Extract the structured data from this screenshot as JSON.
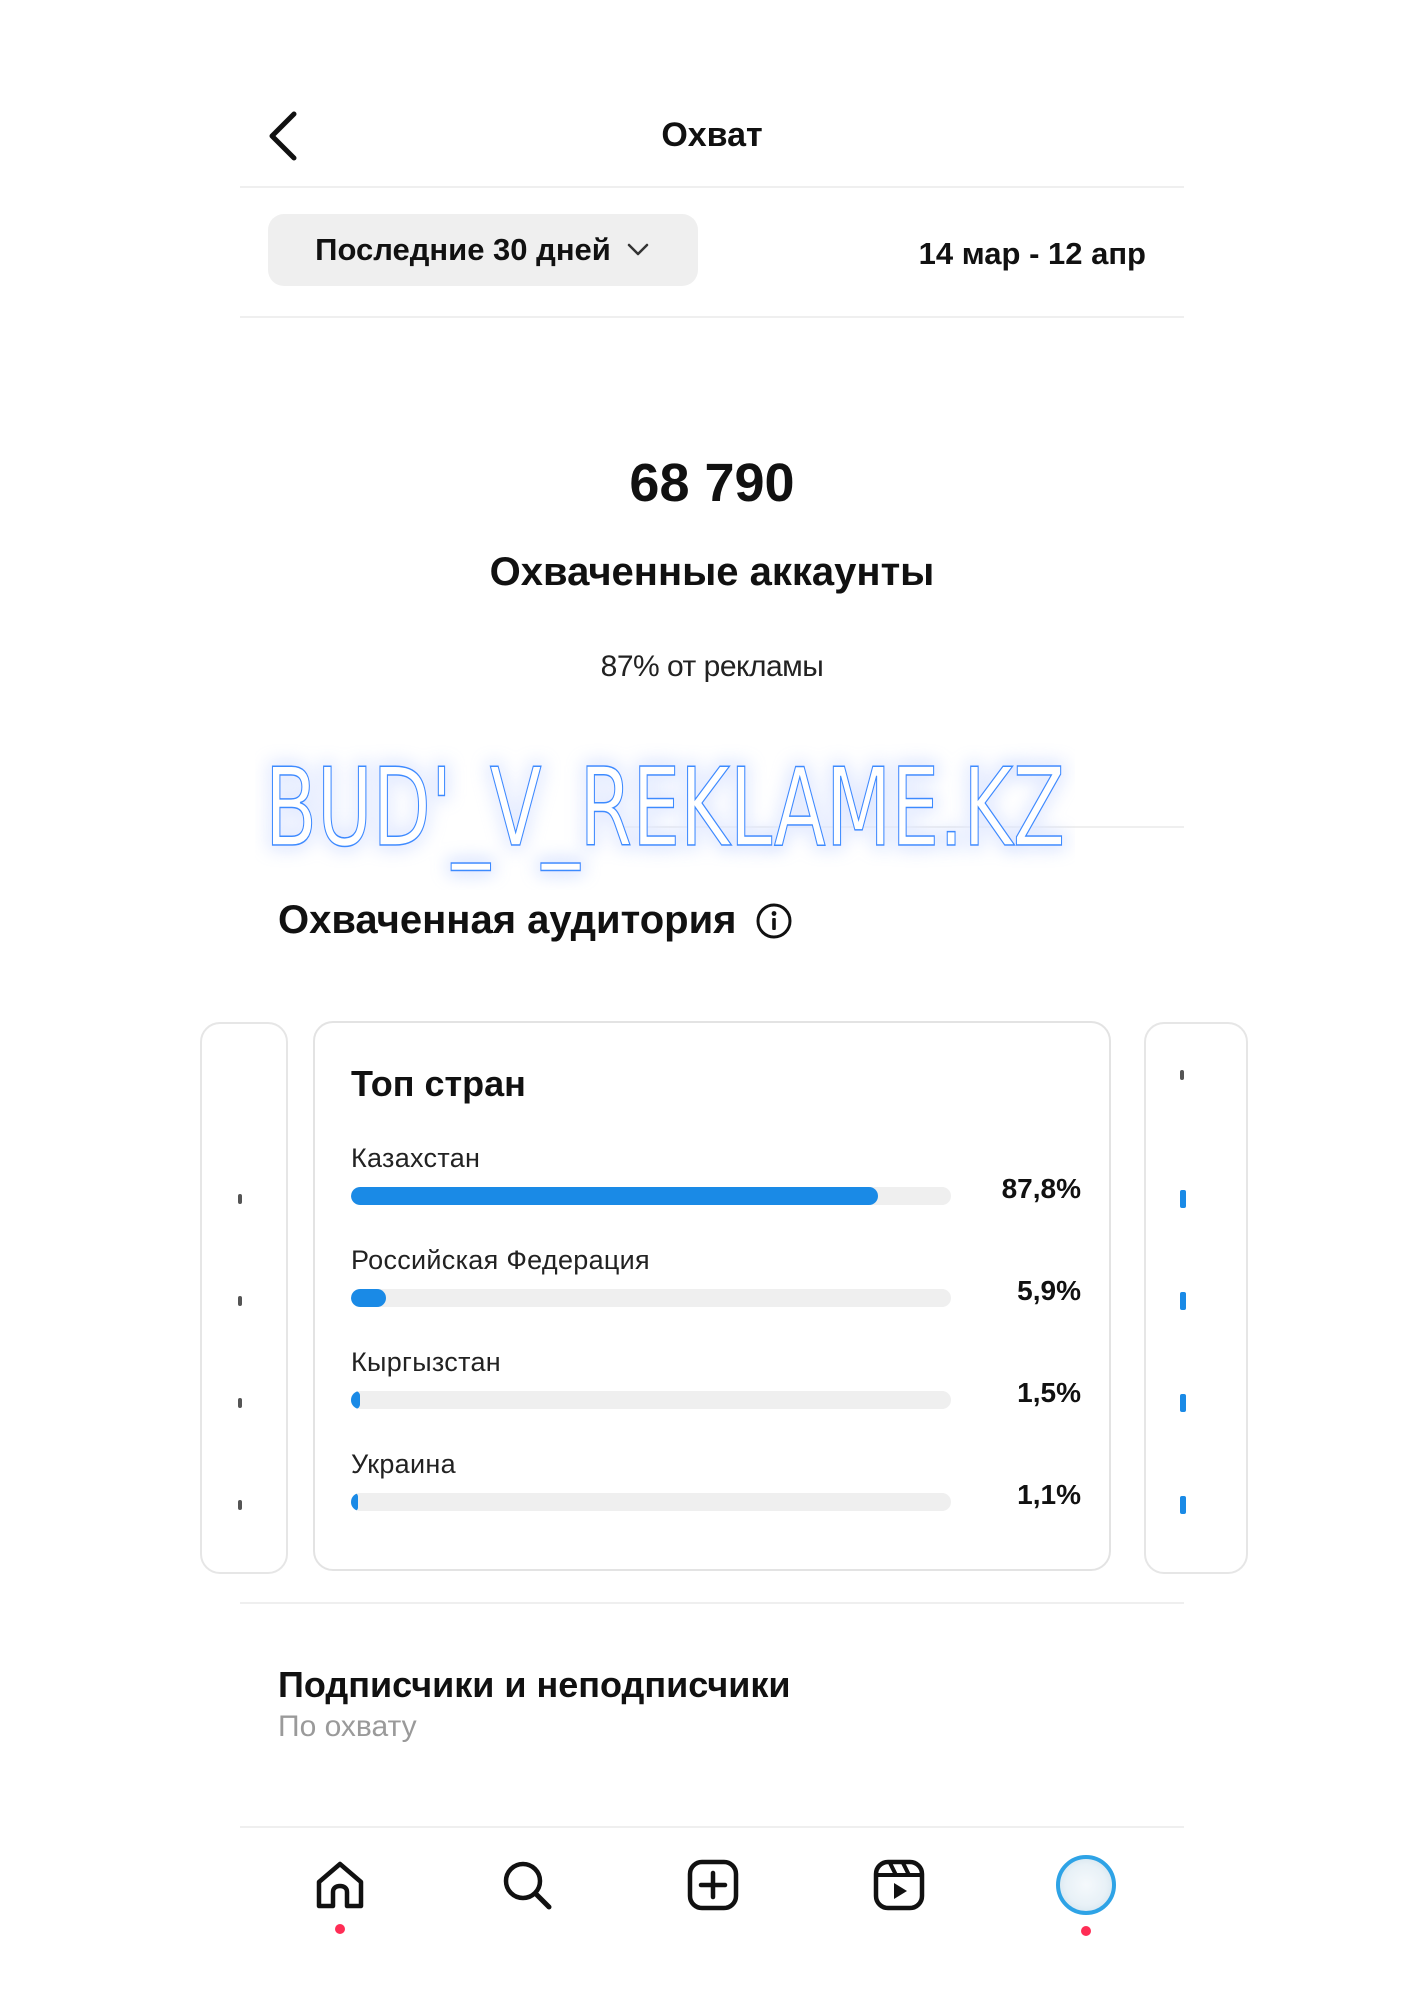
{
  "header": {
    "title": "Охват"
  },
  "period": {
    "label": "Последние 30 дней",
    "date_range": "14 мар - 12 апр"
  },
  "reach": {
    "value": "68 790",
    "label": "Охваченные аккаунты",
    "ads_share": "87% от рекламы"
  },
  "watermark": {
    "text": "BUD'_V_REKLAME.KZ"
  },
  "audience": {
    "title": "Охваченная аудитория",
    "top_countries": {
      "title": "Топ стран",
      "items": [
        {
          "name": "Казахстан",
          "value": "87,8%",
          "fraction": 0.878
        },
        {
          "name": "Российская Федерация",
          "value": "5,9%",
          "fraction": 0.059
        },
        {
          "name": "Кыргызстан",
          "value": "1,5%",
          "fraction": 0.015
        },
        {
          "name": "Украина",
          "value": "1,1%",
          "fraction": 0.011
        }
      ]
    }
  },
  "followers": {
    "title": "Подписчики и неподписчики",
    "subtitle": "По охвату"
  },
  "nav": {
    "icons": [
      "home-icon",
      "search-icon",
      "create-icon",
      "reels-icon",
      "profile-avatar"
    ]
  },
  "colors": {
    "accent": "#1a8ae6",
    "track": "#efefef",
    "muted": "#9a9a9a",
    "notification": "#ff2d55",
    "watermark_glow": "#3d8bff"
  }
}
